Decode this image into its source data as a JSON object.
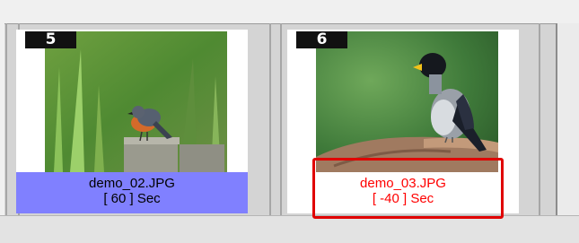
{
  "thumbnails": [
    {
      "number": "5",
      "filename": "demo_02.JPG",
      "duration_label": "[ 60 ] Sec",
      "selected": true
    },
    {
      "number": "6",
      "filename": "demo_03.JPG",
      "duration_label": "[ -40 ] Sec",
      "error": true
    }
  ],
  "colors": {
    "selected_caption_bg": "#8080ff",
    "error_text": "#ff0000",
    "highlight_border": "#e00000"
  }
}
